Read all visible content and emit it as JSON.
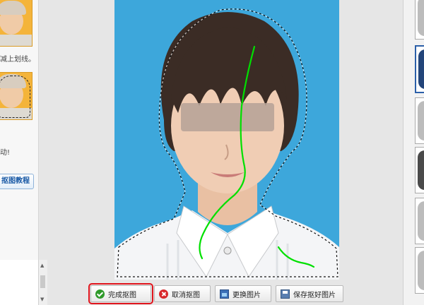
{
  "left_panel": {
    "step_text_1": "减上划线。",
    "step_text_2": "动!",
    "tutorial_button": "抠图教程"
  },
  "canvas": {
    "background_color": "#3da7db",
    "selection_stroke_color": "#00e000"
  },
  "toolbar": {
    "finish_label": "完成抠图",
    "cancel_label": "取消抠图",
    "replace_label": "更换图片",
    "save_label": "保存抠好图片"
  },
  "colors": {
    "highlight_border": "#e0141c",
    "accent_blue": "#1a5aa6"
  }
}
